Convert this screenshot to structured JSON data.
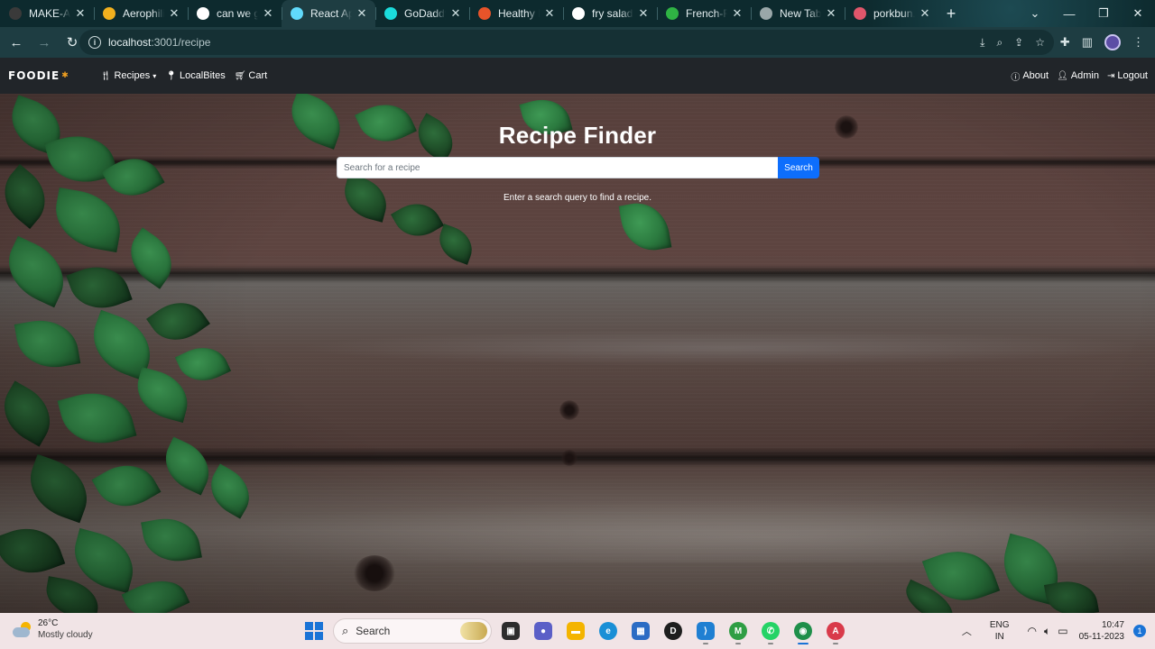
{
  "browser": {
    "tabs": [
      {
        "title": "MAKE-A-THON",
        "favicon_color": "#3a3a3a",
        "active": false
      },
      {
        "title": "Aerophilia",
        "favicon_color": "#f2b01e",
        "active": false
      },
      {
        "title": "can we get",
        "favicon_color": "#ffffff",
        "active": false
      },
      {
        "title": "React App",
        "favicon_color": "#61dafb",
        "active": true
      },
      {
        "title": "GoDaddy",
        "favicon_color": "#1bdbdb",
        "active": false
      },
      {
        "title": "Healthy Ho",
        "favicon_color": "#e8542a",
        "active": false
      },
      {
        "title": "fry salad",
        "favicon_color": "#ffffff",
        "active": false
      },
      {
        "title": "French-Fri",
        "favicon_color": "#2fb344",
        "active": false
      },
      {
        "title": "New Tab",
        "favicon_color": "#9aa7a9",
        "active": false
      },
      {
        "title": "porkbun.c",
        "favicon_color": "#e0566b",
        "active": false
      }
    ],
    "url_host": "localhost",
    "url_path": ":3001/recipe"
  },
  "navbar": {
    "brand": "FOODIE",
    "left_items": [
      {
        "label": "Recipes",
        "icon": "utensils-icon",
        "dropdown": true
      },
      {
        "label": "LocalBites",
        "icon": "map-pin-icon",
        "dropdown": false
      },
      {
        "label": "Cart",
        "icon": "cart-icon",
        "dropdown": false
      }
    ],
    "right_items": [
      {
        "label": "About",
        "icon": "info-icon"
      },
      {
        "label": "Admin",
        "icon": "user-icon"
      },
      {
        "label": "Logout",
        "icon": "logout-icon"
      }
    ]
  },
  "finder": {
    "title": "Recipe Finder",
    "search_placeholder": "Search for a recipe",
    "search_value": "",
    "search_button": "Search",
    "hint": "Enter a search query to find a recipe."
  },
  "taskbar": {
    "weather_temp": "26°C",
    "weather_desc": "Mostly cloudy",
    "search_label": "Search",
    "lang_line1": "ENG",
    "lang_line2": "IN",
    "time": "10:47",
    "date": "05-11-2023",
    "notifications": "1",
    "apps": [
      {
        "name": "task-view-icon",
        "color": "#2d2d2d"
      },
      {
        "name": "meet-icon",
        "color": "#5b5fc7"
      },
      {
        "name": "file-explorer-icon",
        "color": "#f4b400"
      },
      {
        "name": "edge-icon",
        "color": "#1a8fd6"
      },
      {
        "name": "store-icon",
        "color": "#2b6cc4"
      },
      {
        "name": "dell-icon",
        "color": "#1e1e1e"
      },
      {
        "name": "vscode-icon",
        "color": "#1f7fd2"
      },
      {
        "name": "chrome-profile-m-icon",
        "color": "#2f9e44"
      },
      {
        "name": "whatsapp-icon",
        "color": "#25d366"
      },
      {
        "name": "chrome-icon",
        "color": "#1f8f4a"
      },
      {
        "name": "chrome-profile-a-icon",
        "color": "#d93a4a"
      }
    ]
  },
  "colors": {
    "navbar_bg": "#212529",
    "search_button_bg": "#0d6efd",
    "tab_strip_bg": "#0d2a2e",
    "toolbar_bg": "#1e3d42",
    "taskbar_bg": "#f1e4e6"
  }
}
